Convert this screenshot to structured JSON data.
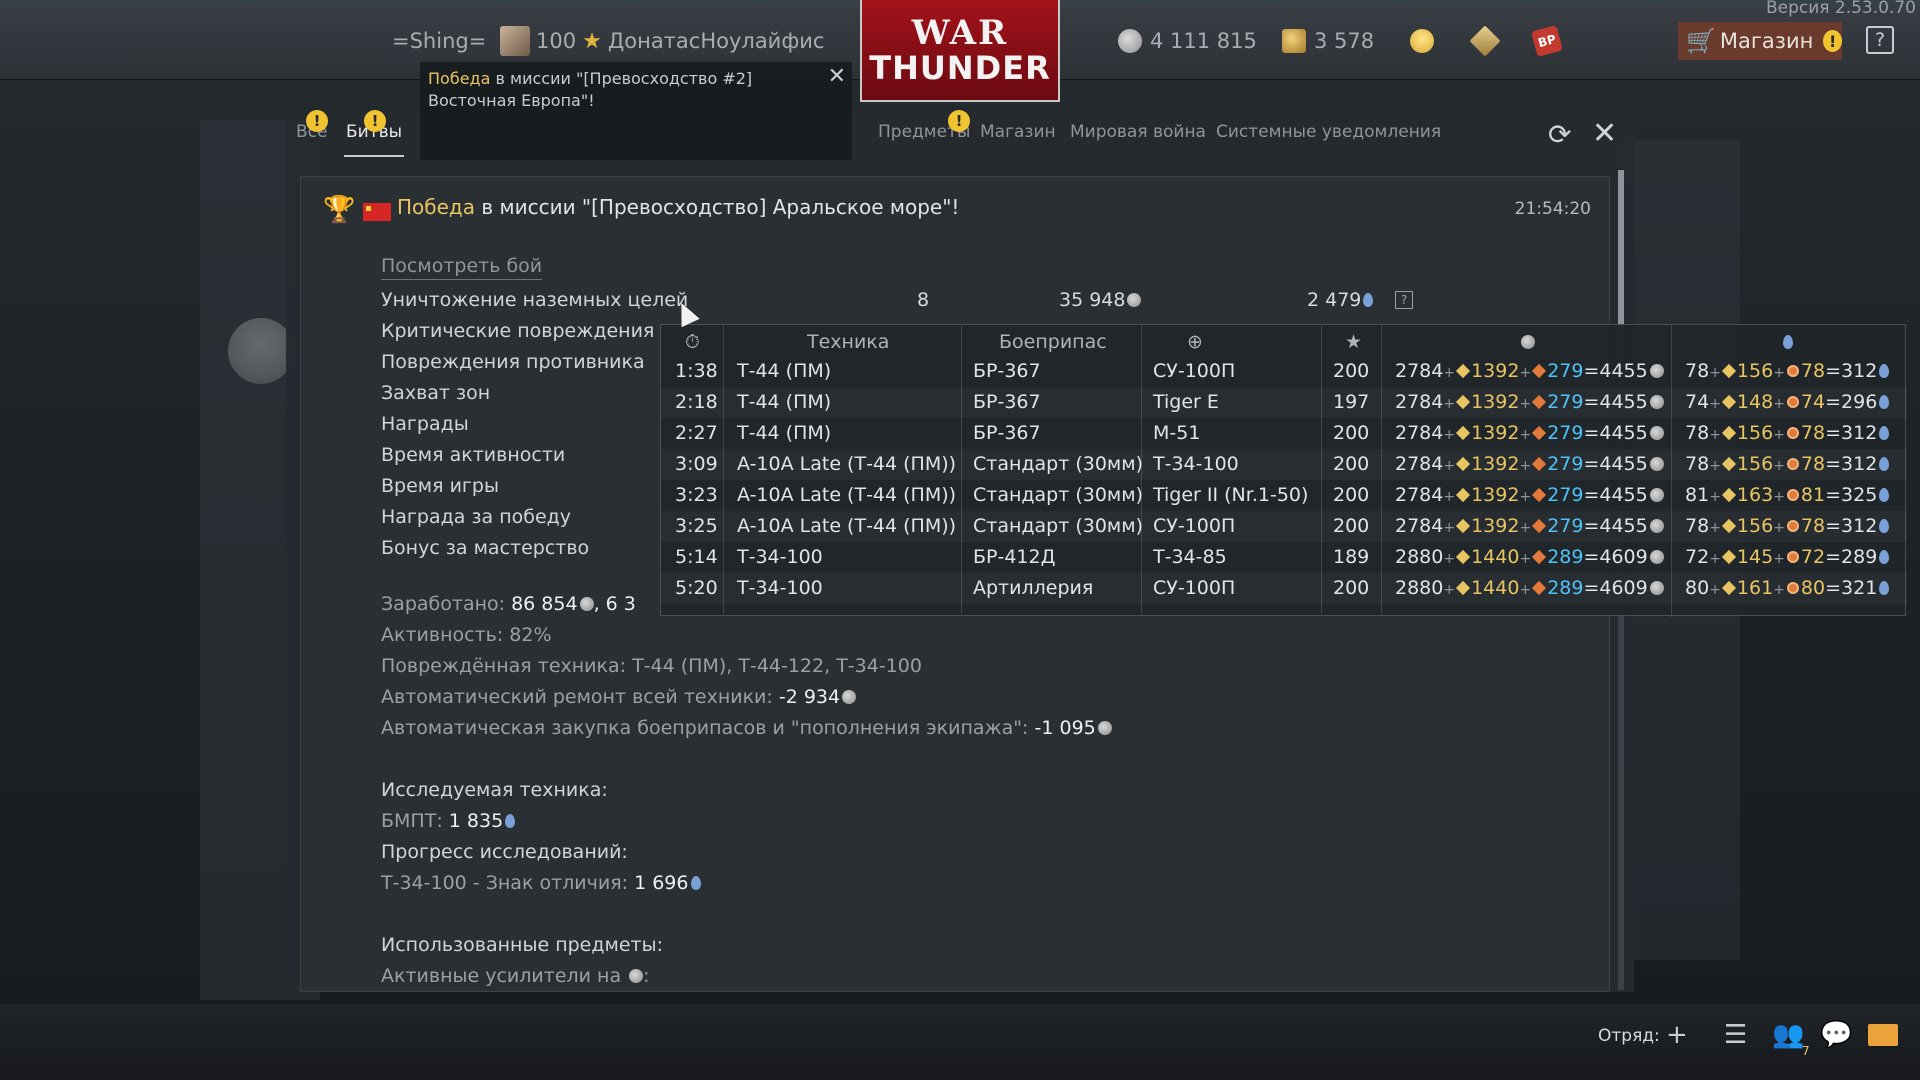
{
  "app": {
    "version": "Версия 2.53.0.70"
  },
  "topbar": {
    "squadron_tag": "=Shing=",
    "player_level": "100",
    "player_name": "ДонатасНоулайфис",
    "logo_top": "WAR",
    "logo_bottom": "THUNDER",
    "silver_lions": "4 111 815",
    "golden_eagles": "3 578",
    "shop_label": "Магазин",
    "help_label": "?"
  },
  "toast": {
    "highlight": "Победа",
    "text": " в миссии \"[Превосходство #2] Восточная Европа\"!"
  },
  "tabs": [
    {
      "label": "Все"
    },
    {
      "label": "Битвы"
    },
    {
      "label": "Предметы"
    },
    {
      "label": "Магазин"
    },
    {
      "label": "Мировая война"
    },
    {
      "label": "Системные уведомления"
    }
  ],
  "message": {
    "title_highlight": "Победа",
    "title_rest": " в миссии \"[Превосходство] Аральское море\"!",
    "time": "21:54:20",
    "view_battle": "Посмотреть бой",
    "stats": [
      {
        "label": "Уничтожение наземных целей",
        "count": "8",
        "lions": "35 948",
        "rp": "2 479"
      },
      {
        "label": "Критические повреждения"
      },
      {
        "label": "Повреждения противника"
      },
      {
        "label": "Захват зон"
      },
      {
        "label": "Награды"
      },
      {
        "label": "Время активности"
      },
      {
        "label": "Время игры"
      },
      {
        "label": "Награда за победу"
      },
      {
        "label": "Бонус за мастерство"
      }
    ],
    "earned_label": "Заработано: ",
    "earned_value": "86 854",
    "earned_tail": ", 6 3",
    "activity_label": "Активность: 82%",
    "damaged_label": "Повреждённая техника: Т-44 (ПМ), Т-44-122, Т-34-100",
    "repair_label": "Автоматический ремонт всей техники: ",
    "repair_value": "-2 934",
    "ammo_label": "Автоматическая закупка боеприпасов и \"пополнения экипажа\": ",
    "ammo_value": "-1 095",
    "research_header": "Исследуемая техника:",
    "research_item_label": "БМПТ: ",
    "research_item_value": "1 835",
    "progress_header": "Прогресс исследований:",
    "progress_item_label": "Т-34-100 - Знак отличия: ",
    "progress_item_value": "1 696",
    "items_header": "Использованные предметы:",
    "boosters_label": "Активные усилители на "
  },
  "tooltip": {
    "headers": {
      "vehicle": "Техника",
      "ammo": "Боеприпас"
    },
    "rows": [
      {
        "time": "1:38",
        "vehicle": "Т-44 (ПМ)",
        "ammo": "БР-367",
        "target": "СУ-100П",
        "score": "200",
        "l1": "2784",
        "l2": "1392",
        "l3": "279",
        "lt": "4455",
        "r1": "78",
        "r2": "156",
        "r3": "78",
        "rt": "312"
      },
      {
        "time": "2:18",
        "vehicle": "Т-44 (ПМ)",
        "ammo": "БР-367",
        "target": "Tiger E",
        "score": "197",
        "l1": "2784",
        "l2": "1392",
        "l3": "279",
        "lt": "4455",
        "r1": "74",
        "r2": "148",
        "r3": "74",
        "rt": "296"
      },
      {
        "time": "2:27",
        "vehicle": "Т-44 (ПМ)",
        "ammo": "БР-367",
        "target": "M-51",
        "score": "200",
        "l1": "2784",
        "l2": "1392",
        "l3": "279",
        "lt": "4455",
        "r1": "78",
        "r2": "156",
        "r3": "78",
        "rt": "312"
      },
      {
        "time": "3:09",
        "vehicle": "A-10A Late (Т-44 (ПМ))",
        "ammo": "Стандарт (30мм)",
        "target": "Т-34-100",
        "score": "200",
        "l1": "2784",
        "l2": "1392",
        "l3": "279",
        "lt": "4455",
        "r1": "78",
        "r2": "156",
        "r3": "78",
        "rt": "312"
      },
      {
        "time": "3:23",
        "vehicle": "A-10A Late (Т-44 (ПМ))",
        "ammo": "Стандарт (30мм)",
        "target": "Tiger II (Nr.1-50)",
        "score": "200",
        "l1": "2784",
        "l2": "1392",
        "l3": "279",
        "lt": "4455",
        "r1": "81",
        "r2": "163",
        "r3": "81",
        "rt": "325"
      },
      {
        "time": "3:25",
        "vehicle": "A-10A Late (Т-44 (ПМ))",
        "ammo": "Стандарт (30мм)",
        "target": "СУ-100П",
        "score": "200",
        "l1": "2784",
        "l2": "1392",
        "l3": "279",
        "lt": "4455",
        "r1": "78",
        "r2": "156",
        "r3": "78",
        "rt": "312"
      },
      {
        "time": "5:14",
        "vehicle": "Т-34-100",
        "ammo": "БР-412Д",
        "target": "Т-34-85",
        "score": "189",
        "l1": "2880",
        "l2": "1440",
        "l3": "289",
        "lt": "4609",
        "r1": "72",
        "r2": "145",
        "r3": "72",
        "rt": "289"
      },
      {
        "time": "5:20",
        "vehicle": "Т-34-100",
        "ammo": "Артиллерия",
        "target": "СУ-100П",
        "score": "200",
        "l1": "2880",
        "l2": "1440",
        "l3": "289",
        "lt": "4609",
        "r1": "80",
        "r2": "161",
        "r3": "80",
        "rt": "321"
      }
    ]
  },
  "bottombar": {
    "squad_label": "Отряд:",
    "contacts_count": "7"
  },
  "colors": {
    "accent_gold": "#e8c562",
    "cyan": "#4fc3f7",
    "shop_bg": "#6a3b2c",
    "logo_red": "#a3121b"
  }
}
